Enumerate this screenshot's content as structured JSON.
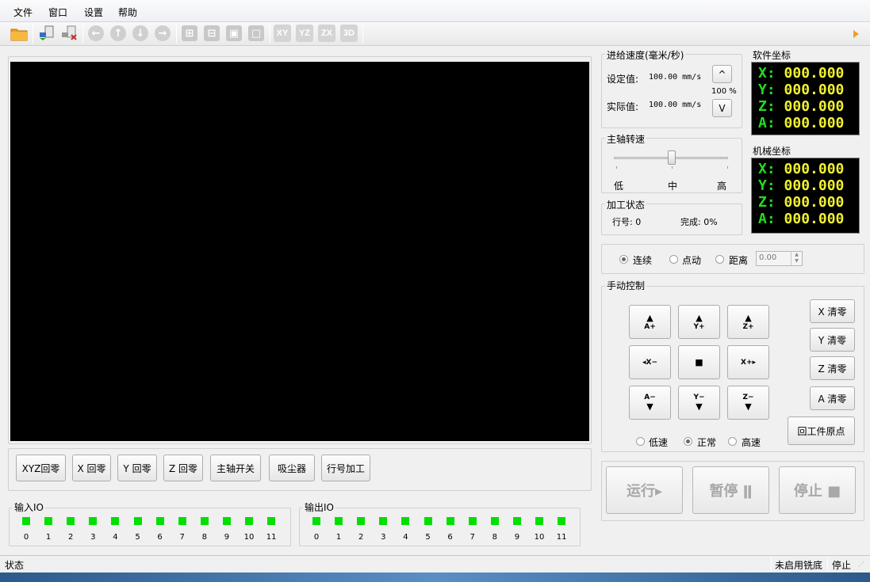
{
  "menu": [
    "文件",
    "窗口",
    "设置",
    "帮助"
  ],
  "toolbar": {
    "icons": [
      "open-folder-icon",
      "upload-icon",
      "download-icon",
      "arrow-left-icon",
      "arrow-up-icon",
      "arrow-down-icon",
      "arrow-right-icon",
      "zoom-in-icon",
      "zoom-out-icon",
      "zoom-fit-icon",
      "zoom-reset-icon"
    ],
    "view_labels": [
      "XY",
      "YZ",
      "ZX",
      "3D"
    ]
  },
  "feed": {
    "title": "进给速度(毫米/秒)",
    "set_label": "设定值:",
    "set_value": "100.00 mm/s",
    "actual_label": "实际值:",
    "actual_value": "100.00 mm/s",
    "percent": "100 %",
    "up_label": "^",
    "down_label": "V"
  },
  "spindle": {
    "title": "主轴转速",
    "low": "低",
    "mid": "中",
    "high": "高",
    "level": 0.5
  },
  "process": {
    "title": "加工状态",
    "line_label": "行号: 0",
    "done_label": "完成: 0%"
  },
  "software_coord": {
    "title": "软件坐标",
    "axes": [
      "X:",
      "Y:",
      "Z:",
      "A:"
    ],
    "values": [
      "000.000",
      "000.000",
      "000.000",
      "000.000"
    ]
  },
  "machine_coord": {
    "title": "机械坐标",
    "axes": [
      "X:",
      "Y:",
      "Z:",
      "A:"
    ],
    "values": [
      "000.000",
      "000.000",
      "000.000",
      "000.000"
    ]
  },
  "mode": {
    "continuous": "连续",
    "step": "点动",
    "distance": "距离",
    "distance_value": "0.00",
    "selected": "连续"
  },
  "manual": {
    "title": "手动控制",
    "jog": [
      "A+",
      "Y+",
      "Z+",
      "◂X−",
      "■",
      "X+▸",
      "A−",
      "Y−",
      "Z−"
    ],
    "zero_buttons": [
      "X 清零",
      "Y 清零",
      "Z 清零",
      "A 清零"
    ],
    "home_button": "回工件原点",
    "speed_low": "低速",
    "speed_normal": "正常",
    "speed_high": "高速",
    "speed_selected": "正常"
  },
  "actions": {
    "xyz_home": "XYZ回零",
    "x_home": "X 回零",
    "y_home": "Y 回零",
    "z_home": "Z 回零",
    "spindle_toggle": "主轴开关",
    "dust": "吸尘器",
    "line_process": "行号加工"
  },
  "run": {
    "run_label": "运行▸",
    "pause_label": "暂停 ǁ",
    "stop_label": "停止 ■"
  },
  "io": {
    "input_title": "输入IO",
    "output_title": "输出IO",
    "numbers": [
      "0",
      "1",
      "2",
      "3",
      "4",
      "5",
      "6",
      "7",
      "8",
      "9",
      "10",
      "11"
    ]
  },
  "status": {
    "left": "状态",
    "middle": "未启用铣底",
    "right": "停止"
  },
  "colors": {
    "led_on": "#00e000",
    "coord_axis": "#22dd22",
    "coord_value": "#f0f030"
  }
}
